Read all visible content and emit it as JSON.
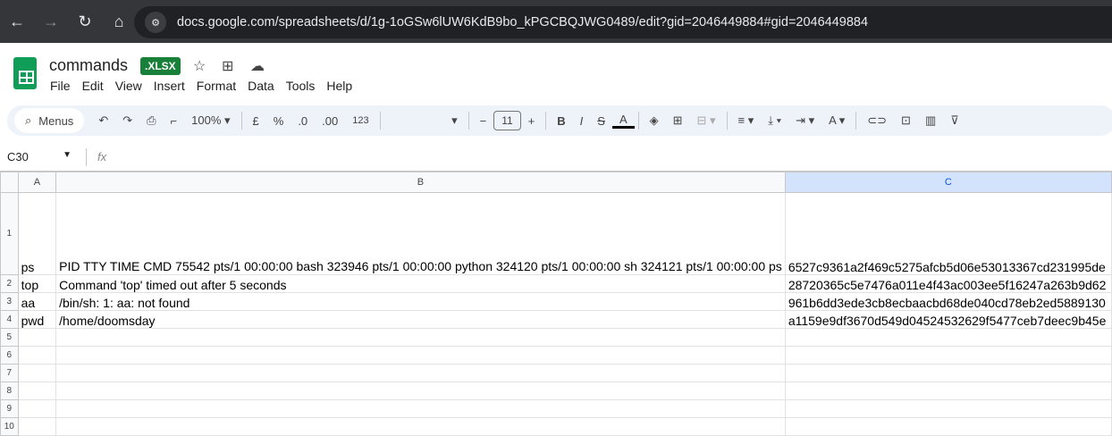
{
  "browser": {
    "url": "docs.google.com/spreadsheets/d/1g-1oGSw6lUW6KdB9bo_kPGCBQJWG0489/edit?gid=2046449884#gid=2046449884"
  },
  "doc": {
    "title": "commands",
    "badge": ".XLSX"
  },
  "menu": [
    "File",
    "Edit",
    "View",
    "Insert",
    "Format",
    "Data",
    "Tools",
    "Help"
  ],
  "toolbar": {
    "search": "Menus",
    "zoom": "100%",
    "currency": "£",
    "percent": "%",
    "dec_less": ".0",
    "dec_more": ".00",
    "format": "123",
    "font_size": "11",
    "bold": "B",
    "italic": "I"
  },
  "formula_bar": {
    "cell_ref": "C30",
    "fx": "fx",
    "value": ""
  },
  "columns": [
    "A",
    "B",
    "C"
  ],
  "rows": [
    {
      "n": "1",
      "a": "ps",
      "b": "PID TTY          TIME CMD\n  75542 pts/1    00:00:00 bash\n 323946 pts/1    00:00:00 python\n 324120 pts/1    00:00:00 sh\n 324121 pts/1    00:00:00 ps",
      "c": "6527c9361a2f469c5275afcb5d06e53013367cd231995de"
    },
    {
      "n": "2",
      "a": "top",
      "b": "Command 'top' timed out after 5 seconds",
      "c": "28720365c5e7476a011e4f43ac003ee5f16247a263b9d62"
    },
    {
      "n": "3",
      "a": "aa",
      "b": "/bin/sh: 1: aa: not found",
      "c": "961b6dd3ede3cb8ecbaacbd68de040cd78eb2ed5889130"
    },
    {
      "n": "4",
      "a": "pwd",
      "b": "/home/doomsday",
      "c": "a1159e9df3670d549d04524532629f5477ceb7deec9b45e"
    },
    {
      "n": "5",
      "a": "",
      "b": "",
      "c": ""
    },
    {
      "n": "6",
      "a": "",
      "b": "",
      "c": ""
    },
    {
      "n": "7",
      "a": "",
      "b": "",
      "c": ""
    },
    {
      "n": "8",
      "a": "",
      "b": "",
      "c": ""
    },
    {
      "n": "9",
      "a": "",
      "b": "",
      "c": ""
    },
    {
      "n": "10",
      "a": "",
      "b": "",
      "c": ""
    }
  ]
}
